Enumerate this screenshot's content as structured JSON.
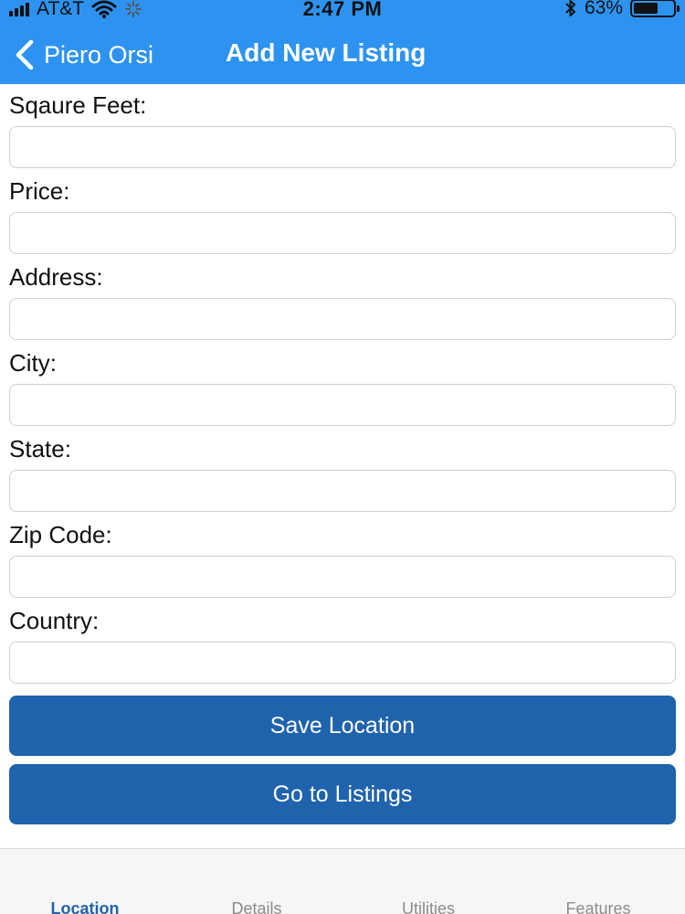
{
  "status_bar": {
    "carrier": "AT&T",
    "time": "2:47 PM",
    "battery": "63%",
    "battery_level": 0.63
  },
  "nav": {
    "back_label": "Piero Orsi",
    "title": "Add New Listing"
  },
  "form": {
    "fields": [
      {
        "label": "Sqaure Feet:",
        "value": ""
      },
      {
        "label": "Price:",
        "value": ""
      },
      {
        "label": "Address:",
        "value": ""
      },
      {
        "label": "City:",
        "value": ""
      },
      {
        "label": "State:",
        "value": ""
      },
      {
        "label": "Zip Code:",
        "value": ""
      },
      {
        "label": "Country:",
        "value": ""
      }
    ]
  },
  "buttons": {
    "save_label": "Save Location",
    "go_label": "Go to Listings"
  },
  "tabs": [
    {
      "label": "Location",
      "active": true
    },
    {
      "label": "Details",
      "active": false
    },
    {
      "label": "Utilities",
      "active": false
    },
    {
      "label": "Features",
      "active": false
    }
  ],
  "colors": {
    "header_bg": "#2e93f0",
    "button_bg": "#1f63ad",
    "active_tab": "#1f63ad",
    "inactive_tab": "#8c8c8c"
  }
}
